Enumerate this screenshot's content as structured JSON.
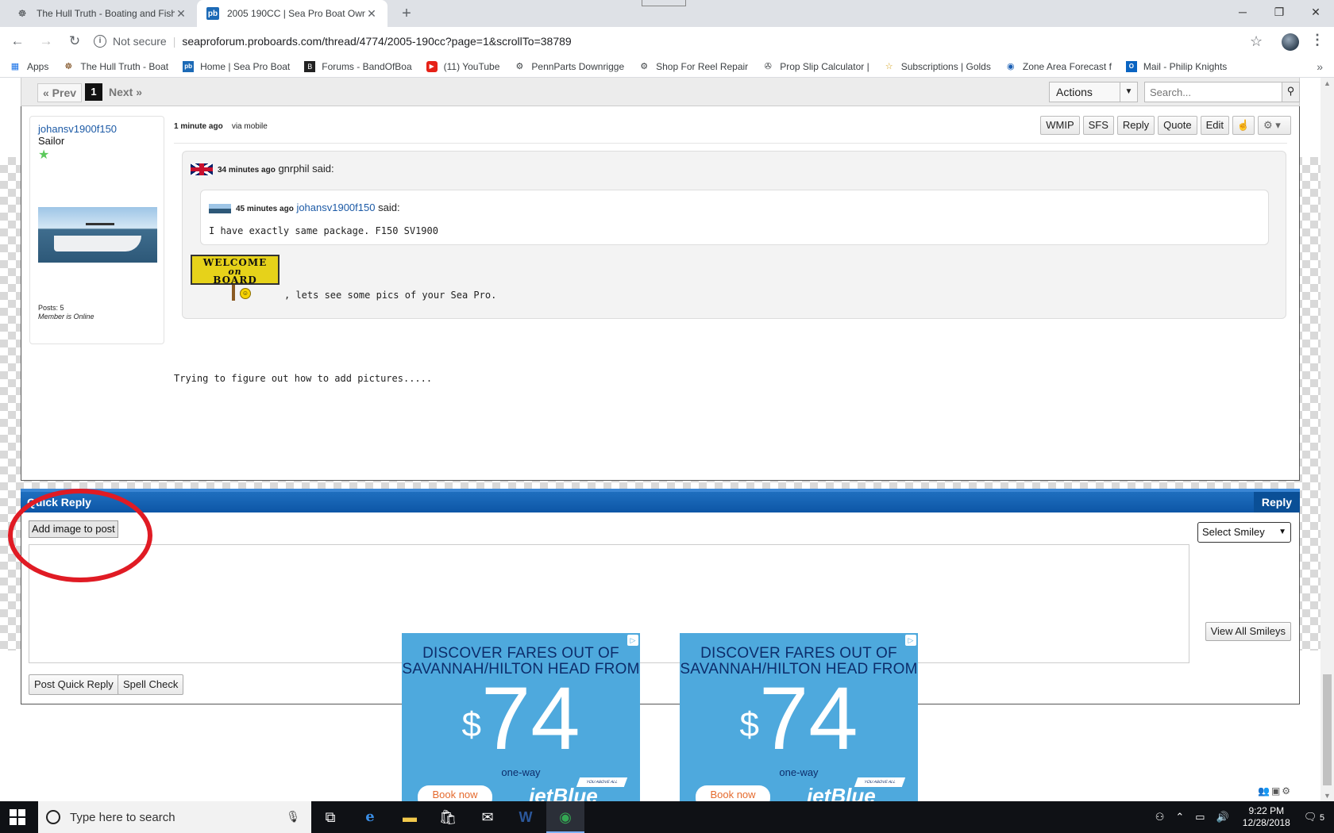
{
  "browser": {
    "tabs": [
      {
        "title": "The Hull Truth - Boating and Fishi",
        "icon": "ship-wheel-icon",
        "active": false
      },
      {
        "title": "2005 190CC | Sea Pro Boat Owne",
        "icon": "proboards-icon",
        "active": true
      }
    ],
    "address": {
      "security": "Not secure",
      "url": "seaproforum.proboards.com/thread/4774/2005-190cc?page=1&scrollTo=38789"
    },
    "bookmarks": [
      {
        "label": "Apps",
        "icon": "apps-grid-icon"
      },
      {
        "label": "The Hull Truth - Boat",
        "icon": "ship-wheel-icon"
      },
      {
        "label": "Home | Sea Pro Boat",
        "icon": "proboards-icon"
      },
      {
        "label": "Forums - BandOfBoa",
        "icon": "bandofboaters-icon"
      },
      {
        "label": "(11) YouTube",
        "icon": "youtube-icon"
      },
      {
        "label": "PennParts Downrigge",
        "icon": "gear-icon"
      },
      {
        "label": "Shop For Reel Repair",
        "icon": "gear-icon"
      },
      {
        "label": "Prop Slip Calculator |",
        "icon": "propeller-icon"
      },
      {
        "label": "Subscriptions | Golds",
        "icon": "star-icon"
      },
      {
        "label": "Zone Area Forecast f",
        "icon": "noaa-icon"
      },
      {
        "label": "Mail - Philip Knights",
        "icon": "outlook-icon"
      }
    ]
  },
  "pagination": {
    "prev": "« Prev",
    "current": "1",
    "next": "Next »",
    "actions": "Actions",
    "search_placeholder": "Search..."
  },
  "post": {
    "author": {
      "name": "johansv1900f150",
      "rank": "Sailor",
      "posts": "Posts: 5",
      "status": "Member is Online"
    },
    "time": "1 minute ago",
    "via": "via mobile",
    "buttons": [
      "WMIP",
      "SFS",
      "Reply",
      "Quote",
      "Edit"
    ],
    "quote": {
      "time": "34 minutes ago",
      "author": "gnrphil",
      "said": "said:",
      "inner_quote": {
        "time": "45 minutes ago",
        "author": "johansv1900f150",
        "said": "said:",
        "text": "I have exactly same package. F150 SV1900"
      },
      "welcome_sign": [
        "WELCOME",
        "on",
        "BOARD"
      ],
      "text": ", lets see some pics of your Sea Pro."
    },
    "body": "Trying to figure out how to add pictures....."
  },
  "quick_reply": {
    "title": "Quick Reply",
    "reply_label": "Reply",
    "add_image": "Add image to post",
    "select_smiley": "Select Smiley",
    "view_all_smileys": "View All Smileys",
    "post_button": "Post Quick Reply",
    "spell_check": "Spell Check"
  },
  "ad": {
    "headline_1": "DISCOVER FARES OUT OF",
    "headline_2": "SAVANNAH/HILTON HEAD FROM",
    "currency": "$",
    "price": "74",
    "oneway": "one-way",
    "cta": "Book now",
    "brand": "jetBlue",
    "tagline": "YOU ABOVE ALL"
  },
  "taskbar": {
    "search_placeholder": "Type here to search",
    "time": "9:22 PM",
    "date": "12/28/2018",
    "notifications": "5"
  },
  "colors": {
    "accent_blue": "#0d56a6",
    "annotation_red": "#e01b24",
    "ad_blue": "#4ea9dd"
  }
}
